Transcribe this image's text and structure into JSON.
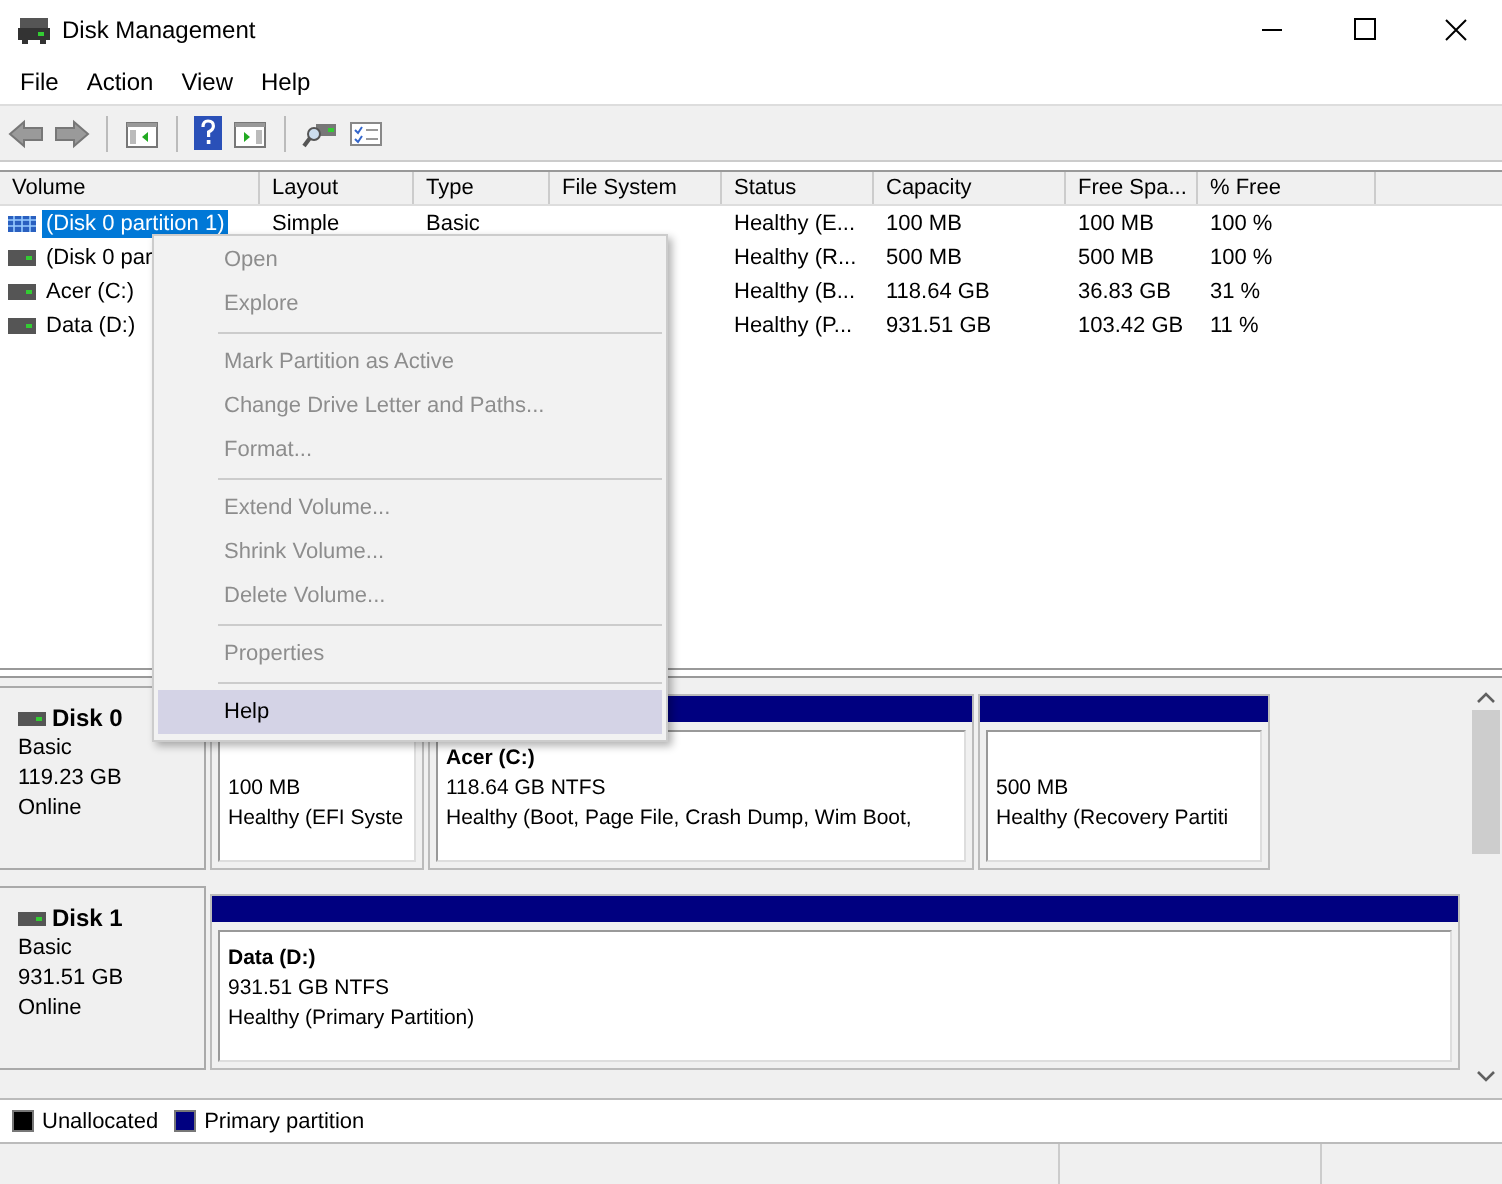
{
  "window": {
    "title": "Disk Management"
  },
  "menu_bar": [
    "File",
    "Action",
    "View",
    "Help"
  ],
  "volume_table": {
    "columns": [
      "Volume",
      "Layout",
      "Type",
      "File System",
      "Status",
      "Capacity",
      "Free Spa...",
      "% Free"
    ],
    "rows": [
      {
        "volume": "(Disk 0 partition 1)",
        "layout": "Simple",
        "type": "Basic",
        "status": "Healthy (E...",
        "capacity": "100 MB",
        "free_space": "100 MB",
        "percent_free": "100 %",
        "selected": true
      },
      {
        "volume": "(Disk 0 par",
        "status": "Healthy (R...",
        "capacity": "500 MB",
        "free_space": "500 MB",
        "percent_free": "100 %",
        "selected": false
      },
      {
        "volume": "Acer (C:)",
        "status": "Healthy (B...",
        "capacity": "118.64 GB",
        "free_space": "36.83 GB",
        "percent_free": "31 %",
        "selected": false
      },
      {
        "volume": "Data (D:)",
        "status": "Healthy (P...",
        "capacity": "931.51 GB",
        "free_space": "103.42 GB",
        "percent_free": "11 %",
        "selected": false
      }
    ]
  },
  "disks": [
    {
      "name": "Disk 0",
      "type": "Basic",
      "size": "119.23 GB",
      "status": "Online",
      "partitions": [
        {
          "size_line": "100 MB",
          "status": "Healthy (EFI Syste"
        },
        {
          "name": "Acer  (C:)",
          "size_line": "118.64 GB NTFS",
          "status": "Healthy (Boot, Page File, Crash Dump, Wim Boot,"
        },
        {
          "size_line": "500 MB",
          "status": "Healthy (Recovery Partiti"
        }
      ]
    },
    {
      "name": "Disk 1",
      "type": "Basic",
      "size": "931.51 GB",
      "status": "Online",
      "partitions": [
        {
          "name": "Data  (D:)",
          "size_line": "931.51 GB NTFS",
          "status": "Healthy (Primary Partition)"
        }
      ]
    }
  ],
  "legend": [
    {
      "label": "Unallocated",
      "color": "#000000"
    },
    {
      "label": "Primary partition",
      "color": "#000080"
    }
  ],
  "context_menu": [
    {
      "kind": "item",
      "label": "Open",
      "disabled": true,
      "selected": false
    },
    {
      "kind": "item",
      "label": "Explore",
      "disabled": true,
      "selected": false
    },
    {
      "kind": "separator"
    },
    {
      "kind": "item",
      "label": "Mark Partition as Active",
      "disabled": true,
      "selected": false
    },
    {
      "kind": "item",
      "label": "Change Drive Letter and Paths...",
      "disabled": true,
      "selected": false
    },
    {
      "kind": "item",
      "label": "Format...",
      "disabled": true,
      "selected": false
    },
    {
      "kind": "separator"
    },
    {
      "kind": "item",
      "label": "Extend Volume...",
      "disabled": true,
      "selected": false
    },
    {
      "kind": "item",
      "label": "Shrink Volume...",
      "disabled": true,
      "selected": false
    },
    {
      "kind": "item",
      "label": "Delete Volume...",
      "disabled": true,
      "selected": false
    },
    {
      "kind": "separator"
    },
    {
      "kind": "item",
      "label": "Properties",
      "disabled": true,
      "selected": false
    },
    {
      "kind": "separator"
    },
    {
      "kind": "item",
      "label": "Help",
      "disabled": false,
      "selected": true
    }
  ]
}
